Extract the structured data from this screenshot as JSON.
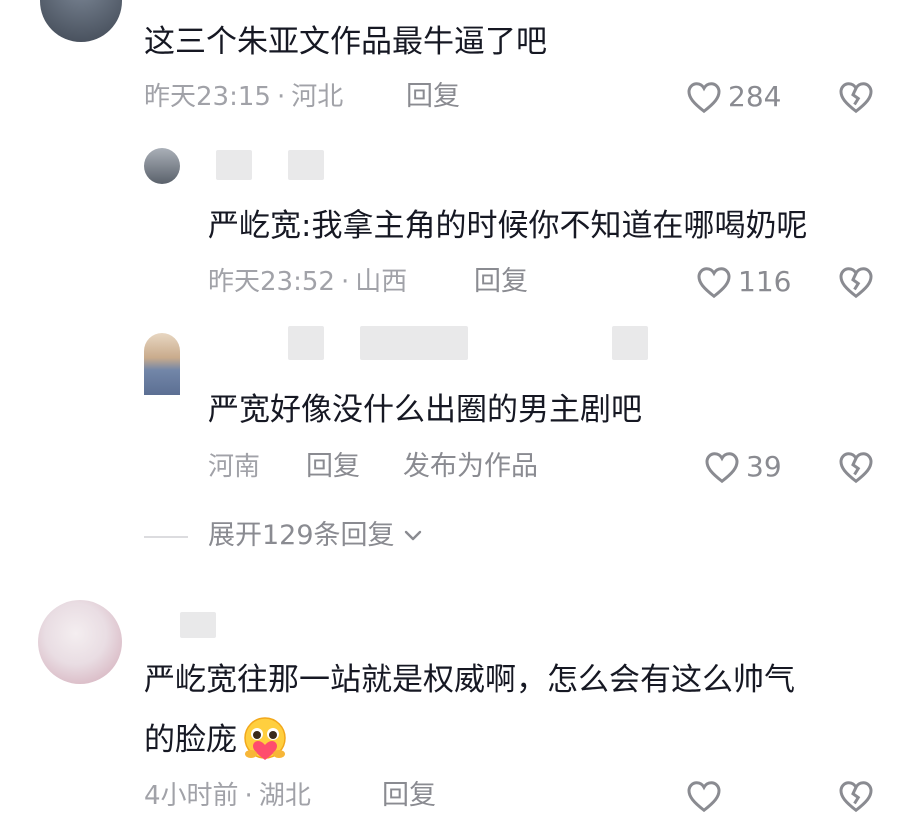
{
  "comments": [
    {
      "text": "这三个朱亚文作品最牛逼了吧",
      "time": "昨天23:15",
      "location": "河北",
      "reply_label": "回复",
      "likes": "284"
    },
    {
      "text": "严屹宽:我拿主角的时候你不知道在哪喝奶呢",
      "time": "昨天23:52",
      "location": "山西",
      "reply_label": "回复",
      "likes": "116"
    },
    {
      "text": "严宽好像没什么出圈的男主剧吧",
      "location": "河南",
      "reply_label": "回复",
      "publish_label": "发布为作品",
      "likes": "39"
    },
    {
      "text_line1": "严屹宽往那一站就是权威啊，怎么会有这么帅气",
      "text_line2": "的脸庞",
      "time": "4小时前",
      "location": "湖北",
      "reply_label": "回复"
    }
  ],
  "expand_replies": "展开129条回复",
  "icons": {
    "like": "heart-outline-icon",
    "dislike": "broken-heart-icon",
    "expand": "chevron-down-icon",
    "emoji": "heart-hands-emoji-icon"
  },
  "colors": {
    "text": "#161823",
    "meta": "#a1a2a8",
    "action": "#8a8b91"
  }
}
